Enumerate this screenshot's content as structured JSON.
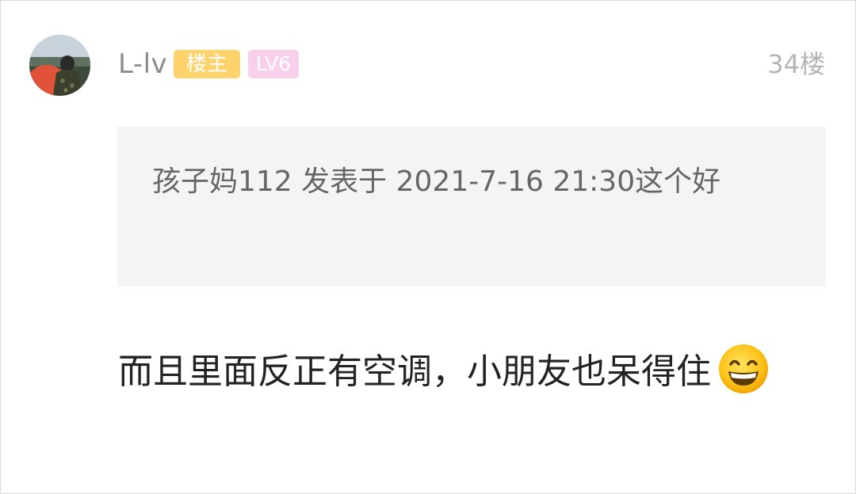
{
  "post": {
    "author": {
      "name": "L-lv",
      "owner_badge": "楼主",
      "level_badge": "LV6"
    },
    "floor": "34楼",
    "quote": {
      "text": "孩子妈112 发表于 2021-7-16 21:30这个好"
    },
    "content": {
      "text": "而且里面反正有空调，小朋友也呆得住",
      "emoji": "grinning-face-icon"
    }
  },
  "colors": {
    "owner_badge_bg": "#ffd36b",
    "level_badge_bg": "#f9d0ec",
    "quote_bg": "#f4f4f4",
    "username": "#8c8c8c",
    "floor": "#b5b5b5"
  }
}
